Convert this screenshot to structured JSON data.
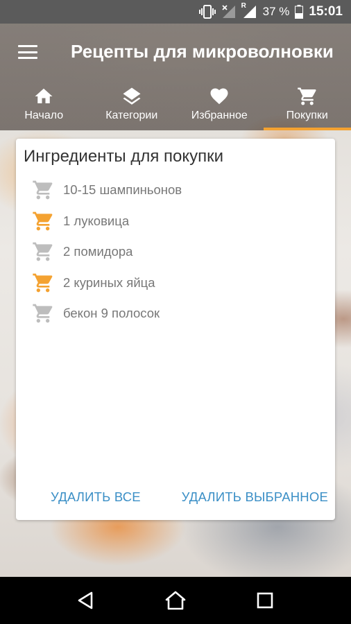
{
  "status_bar": {
    "battery_percent": "37 %",
    "time": "15:01",
    "roaming": "R",
    "icons": [
      "vibrate-icon",
      "signal-no-data-icon",
      "signal-roaming-icon",
      "battery-icon"
    ]
  },
  "header": {
    "title": "Рецепты для микроволновки",
    "menu_icon": "hamburger-menu-icon"
  },
  "tabs": [
    {
      "label": "Начало",
      "icon": "home-icon",
      "active": false
    },
    {
      "label": "Категории",
      "icon": "layers-icon",
      "active": false
    },
    {
      "label": "Избранное",
      "icon": "heart-icon",
      "active": false
    },
    {
      "label": "Покупки",
      "icon": "shopping-cart-icon",
      "active": true
    }
  ],
  "shopping_card": {
    "title": "Ингредиенты для покупки",
    "items": [
      {
        "label": "10-15 шампиньонов",
        "selected": false
      },
      {
        "label": "1 луковица",
        "selected": true
      },
      {
        "label": "2 помидора",
        "selected": false
      },
      {
        "label": "2 куриных яйца",
        "selected": true
      },
      {
        "label": "бекон 9 полосок",
        "selected": false
      }
    ],
    "delete_all_label": "УДАЛИТЬ ВСЕ",
    "delete_selected_label": "УДАЛИТЬ ВЫБРАННОЕ"
  },
  "colors": {
    "accent": "#f4a231",
    "cart_inactive": "#bdbdbd",
    "action_text": "#3b8fc6",
    "status_bar": "#5b5b5b",
    "nav_bar": "#000000"
  },
  "nav_bar": {
    "buttons": [
      "back-icon",
      "home-nav-icon",
      "recents-icon"
    ]
  }
}
